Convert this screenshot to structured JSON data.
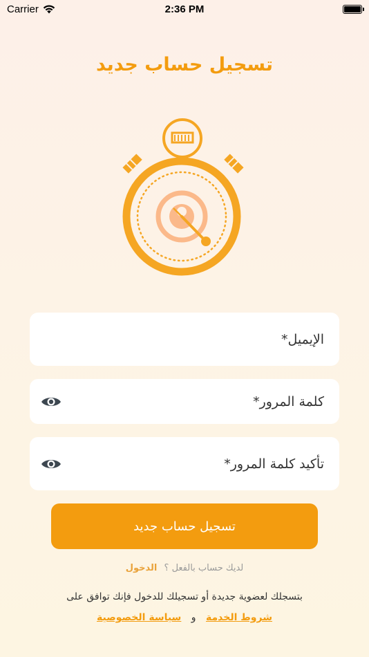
{
  "status_bar": {
    "carrier": "Carrier",
    "time": "2:36 PM"
  },
  "page": {
    "title": "تسجيل حساب جديد"
  },
  "form": {
    "email_label": "الإيميل*",
    "password_label": "كلمة المرور*",
    "confirm_password_label": "تأكيد كلمة المرور*"
  },
  "actions": {
    "register_label": "تسجيل حساب جديد",
    "have_account_text": "لديك حساب بالفعل ؟",
    "login_link": "الدخول"
  },
  "terms": {
    "notice": "بتسجلك لعضوية جديدة أو تسجيلك للدخول فإنك توافق على",
    "terms_of_service": "شروط الخدمة",
    "and": "و",
    "privacy_policy": "سياسة الخصوصية"
  },
  "colors": {
    "accent": "#f39c0f",
    "field_bg": "#ffffff",
    "eye": "#3d4750"
  },
  "icons": {
    "logo": "stopwatch-logo-icon",
    "eye": "eye-icon",
    "wifi": "wifi-icon",
    "battery": "battery-icon"
  }
}
